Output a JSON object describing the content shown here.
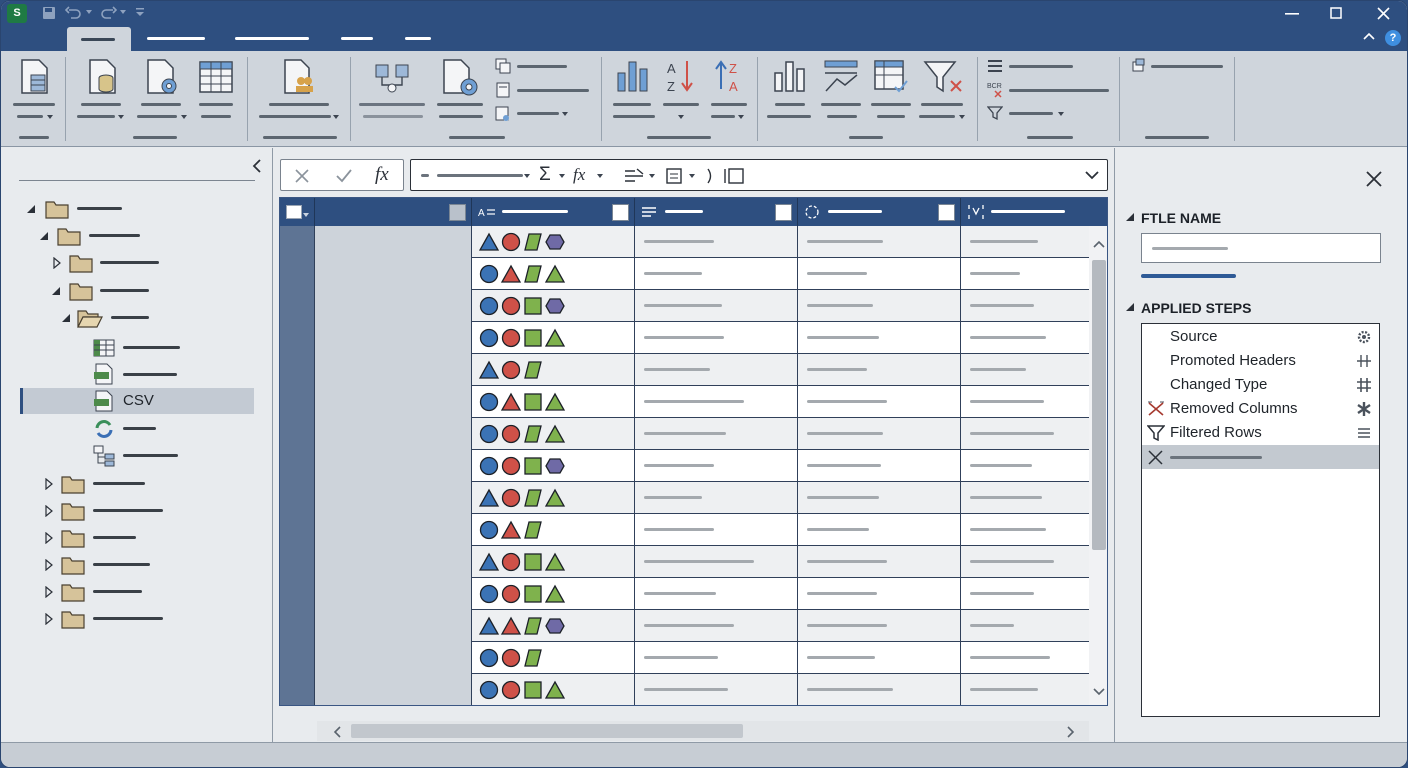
{
  "window": {
    "app_icon_letter": "S"
  },
  "tree": {
    "selected_item_label": "CSV"
  },
  "right_panel": {
    "name_section_title": "FTLE NAME",
    "steps_section_title": "APPLIED STEPS",
    "steps": [
      {
        "label": "Source",
        "icon": "gear-icon"
      },
      {
        "label": "Promoted Headers",
        "icon": "columns-icon"
      },
      {
        "label": "Changed Type",
        "icon": "grid-icon"
      },
      {
        "label": "Removed Columns",
        "icon": "remove-columns-icon"
      },
      {
        "label": "Filtered Rows",
        "icon": "filter-icon"
      }
    ]
  },
  "formula_bar": {
    "fx_label": "fx",
    "sigma_label": "Σ"
  },
  "grid": {
    "row_shapes": [
      [
        "tri",
        "circ",
        "para",
        "hex"
      ],
      [
        "circ",
        "tri",
        "para",
        "tri"
      ],
      [
        "circ",
        "circ",
        "sq",
        "hex"
      ],
      [
        "circ",
        "circ",
        "sq",
        "tri"
      ],
      [
        "tri",
        "circ",
        "para"
      ],
      [
        "circ",
        "tri",
        "sq",
        "tri"
      ],
      [
        "circ",
        "circ",
        "para",
        "tri"
      ],
      [
        "circ",
        "circ",
        "sq",
        "hex"
      ],
      [
        "tri",
        "circ",
        "para",
        "tri"
      ],
      [
        "circ",
        "tri",
        "para"
      ],
      [
        "tri",
        "circ",
        "sq",
        "tri"
      ],
      [
        "circ",
        "circ",
        "sq",
        "tri"
      ],
      [
        "tri",
        "tri",
        "para",
        "hex"
      ],
      [
        "circ",
        "circ",
        "para"
      ],
      [
        "circ",
        "circ",
        "sq",
        "tri"
      ]
    ]
  },
  "colors": {
    "accent": "#2e4f80",
    "shape_blue": "#3b73b5",
    "shape_red": "#cf5148",
    "shape_green": "#7fb24d",
    "shape_purple": "#6f6aa6"
  }
}
